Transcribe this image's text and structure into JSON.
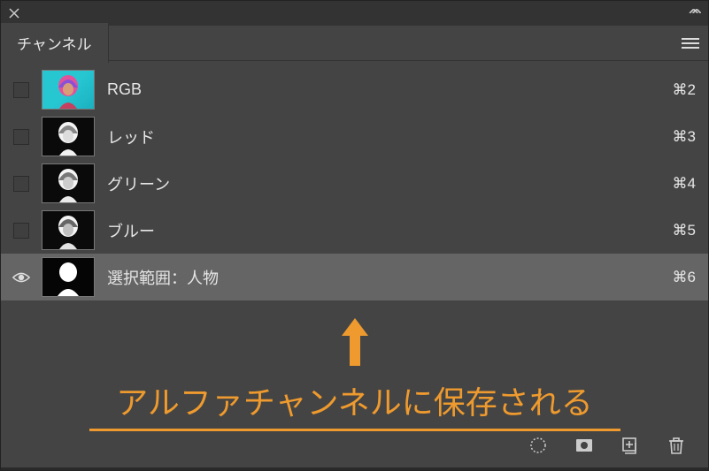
{
  "titlebar": {},
  "tab": {
    "label": "チャンネル"
  },
  "channels": [
    {
      "name": "RGB",
      "shortcut": "⌘2",
      "type": "rgb",
      "selected": false,
      "visible_box": true
    },
    {
      "name": "レッド",
      "shortcut": "⌘3",
      "type": "gray",
      "selected": false,
      "visible_box": true
    },
    {
      "name": "グリーン",
      "shortcut": "⌘4",
      "type": "gray",
      "selected": false,
      "visible_box": true
    },
    {
      "name": "ブルー",
      "shortcut": "⌘5",
      "type": "gray",
      "selected": false,
      "visible_box": true
    },
    {
      "name": "選択範囲：人物",
      "shortcut": "⌘6",
      "type": "alpha",
      "selected": true,
      "visible_box": false
    }
  ],
  "annotation": {
    "text": "アルファチャンネルに保存される"
  },
  "footer": {
    "load_selection": "load-selection",
    "save_selection": "save-selection",
    "new_channel": "new-channel",
    "delete_channel": "delete-channel"
  }
}
